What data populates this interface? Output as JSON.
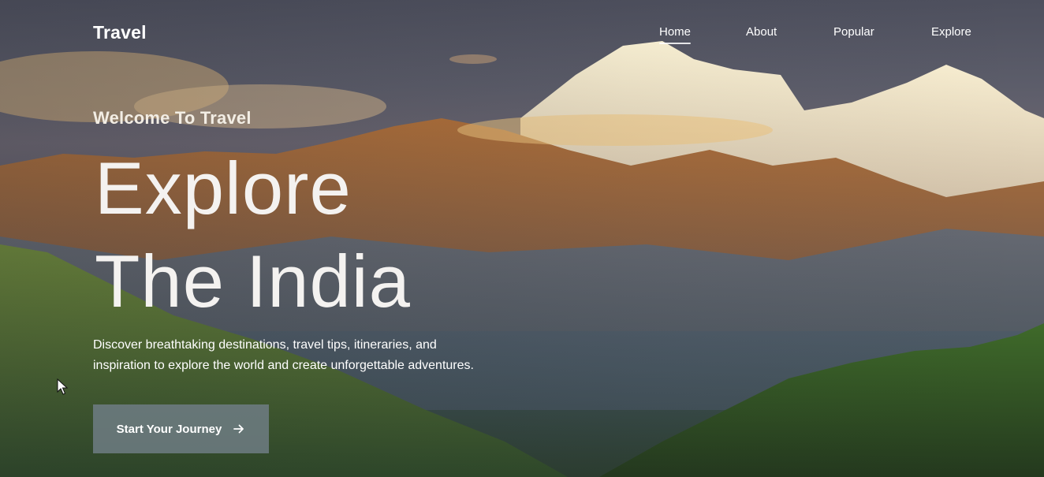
{
  "brand": "Travel",
  "nav": {
    "home": "Home",
    "about": "About",
    "popular": "Popular",
    "explore": "Explore",
    "active": "Home"
  },
  "hero": {
    "welcome": "Welcome To Travel",
    "headline_line1": "Explore",
    "headline_line2": "The India",
    "description_line1": "Discover breathtaking destinations, travel tips, itineraries, and",
    "description_line2": "inspiration to explore the world and create unforgettable adventures.",
    "cta_label": "Start Your Journey",
    "cta_icon": "arrow-right-icon"
  },
  "colors": {
    "text": "#ffffff",
    "cta_background": "#6e7d84"
  }
}
